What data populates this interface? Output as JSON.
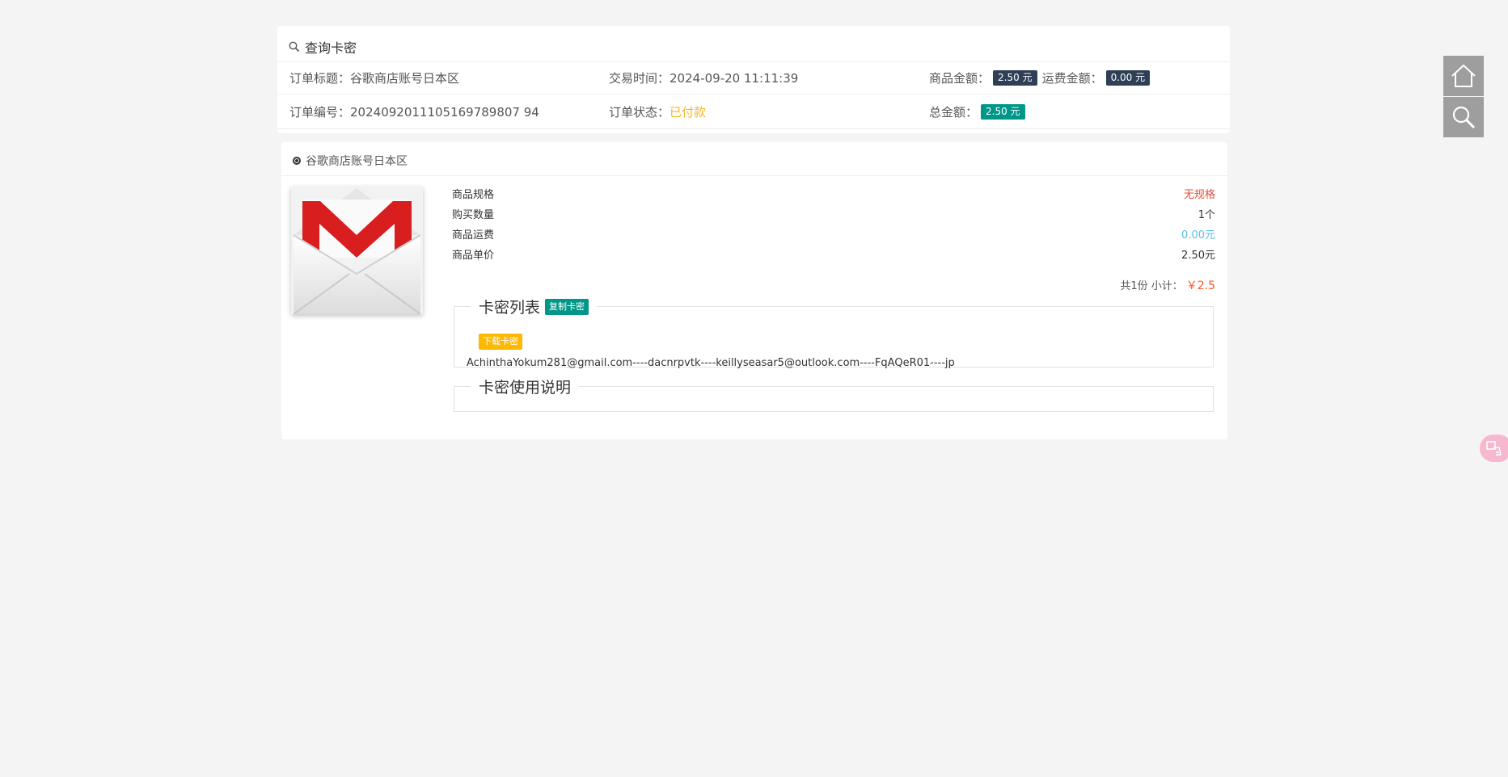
{
  "query": {
    "title": "查询卡密",
    "order_title_label": "订单标题：",
    "order_title_value": "谷歌商店账号日本区",
    "trade_time_label": "交易时间：",
    "trade_time_value": "2024-09-20 11:11:39",
    "goods_amount_label": "商品金额：",
    "goods_amount_value": "2.50 元",
    "shipping_amount_label": "运费金额：",
    "shipping_amount_value": "0.00 元",
    "order_no_label": "订单编号：",
    "order_no_value": "2024092011105169789807 94",
    "status_label": "订单状态：",
    "status_value": "已付款",
    "total_label": "总金额：",
    "total_value": "2.50 元"
  },
  "product": {
    "name": "谷歌商店账号日本区",
    "image_icon": "gmail-envelope-icon",
    "rows": [
      {
        "label": "商品规格",
        "value": "无规格"
      },
      {
        "label": "购买数量",
        "value": "1个"
      },
      {
        "label": "商品运费",
        "value": "0.00元"
      },
      {
        "label": "商品单价",
        "value": "2.50元"
      }
    ],
    "subtotal_label": "共1份 小计：",
    "subtotal_value": "￥2.5"
  },
  "card_list": {
    "legend": "卡密列表",
    "copy_button": "复制卡密",
    "download_button": "下载卡密",
    "content": "AchinthaYokum281@gmail.com----dacnrpvtk----keillyseasar5@outlook.com----FqAQeR01----jp"
  },
  "usage": {
    "legend": "卡密使用说明"
  },
  "side": {
    "home_icon": "home-icon",
    "search_icon": "search-icon",
    "translate_icon": "translate-icon"
  },
  "colors": {
    "teal": "#009688",
    "dark_badge": "#2f4056",
    "gold": "#ffb800",
    "paid": "#f7b824",
    "price": "#ff5722",
    "red": "#e74c3c"
  }
}
